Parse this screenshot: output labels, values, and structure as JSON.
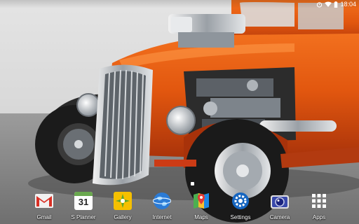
{
  "status_bar": {
    "time": "18:04",
    "icons": [
      "alarm-icon",
      "wifi-icon",
      "battery-icon"
    ]
  },
  "home": {
    "current_page_index": 1
  },
  "dock": {
    "apps": [
      {
        "label": "Gmail",
        "icon": "gmail-icon"
      },
      {
        "label": "S Planner",
        "icon": "calendar-icon",
        "calendar_day": "31"
      },
      {
        "label": "Gallery",
        "icon": "gallery-icon"
      },
      {
        "label": "Internet",
        "icon": "globe-icon"
      },
      {
        "label": "Maps",
        "icon": "maps-icon"
      },
      {
        "label": "Settings",
        "icon": "settings-gear-icon"
      },
      {
        "label": "Camera",
        "icon": "camera-icon"
      },
      {
        "label": "Apps",
        "icon": "app-grid-icon"
      }
    ]
  },
  "colors": {
    "accent_orange": "#e2570f",
    "chrome": "#c9cdd2"
  }
}
